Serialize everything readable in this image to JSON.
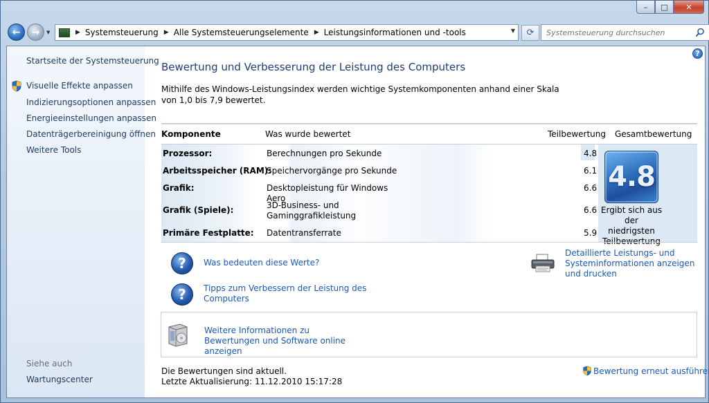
{
  "window": {
    "minimize_label": "–",
    "maximize_label": "□",
    "close_label": "✕"
  },
  "address": {
    "breadcrumbs": [
      "Systemsteuerung",
      "Alle Systemsteuerungselemente",
      "Leistungsinformationen und -tools"
    ]
  },
  "search": {
    "placeholder": "Systemsteuerung durchsuchen"
  },
  "sidebar": {
    "home": "Startseite der Systemsteuerung",
    "items": [
      "Visuelle Effekte anpassen",
      "Indizierungsoptionen anpassen",
      "Energieeinstellungen anpassen",
      "Datenträgerbereinigung öffnen",
      "Weitere Tools"
    ],
    "see_also_heading": "Siehe auch",
    "see_also": [
      "Wartungscenter"
    ]
  },
  "main": {
    "title": "Bewertung und Verbesserung der Leistung des Computers",
    "intro": "Mithilfe des Windows-Leistungsindex werden wichtige Systemkomponenten anhand einer Skala von 1,0 bis 7,9 bewertet.",
    "table": {
      "headers": [
        "Komponente",
        "Was wurde bewertet",
        "Teilbewertung",
        "Gesamtbewertung"
      ],
      "rows": [
        {
          "component": "Prozessor:",
          "rated": "Berechnungen pro Sekunde",
          "score": "4.8"
        },
        {
          "component": "Arbeitsspeicher (RAM):",
          "rated": "Speichervorgänge pro Sekunde",
          "score": "6.1"
        },
        {
          "component": "Grafik:",
          "rated": "Desktopleistung für Windows Aero",
          "score": "6.6"
        },
        {
          "component": "Grafik (Spiele):",
          "rated": "3D-Business- und Gaminggrafikleistung",
          "score": "6.6"
        },
        {
          "component": "Primäre Festplatte:",
          "rated": "Datentransferrate",
          "score": "5.9"
        }
      ],
      "base_score": "4.8",
      "base_score_note": "Ergibt sich aus der niedrigsten Teilbewertung"
    },
    "links": {
      "what_mean": "Was bedeuten diese Werte?",
      "tips": "Tipps zum Verbessern der Leistung des Computers",
      "details": "Detaillierte Leistungs- und Systeminformationen anzeigen und drucken",
      "online": "Weitere Informationen zu Bewertungen und Software online anzeigen"
    },
    "status": {
      "line1": "Die Bewertungen sind aktuell.",
      "line2": "Letzte Aktualisierung: 11.12.2010 15:17:28"
    },
    "rerun": "Bewertung erneut ausführen"
  }
}
